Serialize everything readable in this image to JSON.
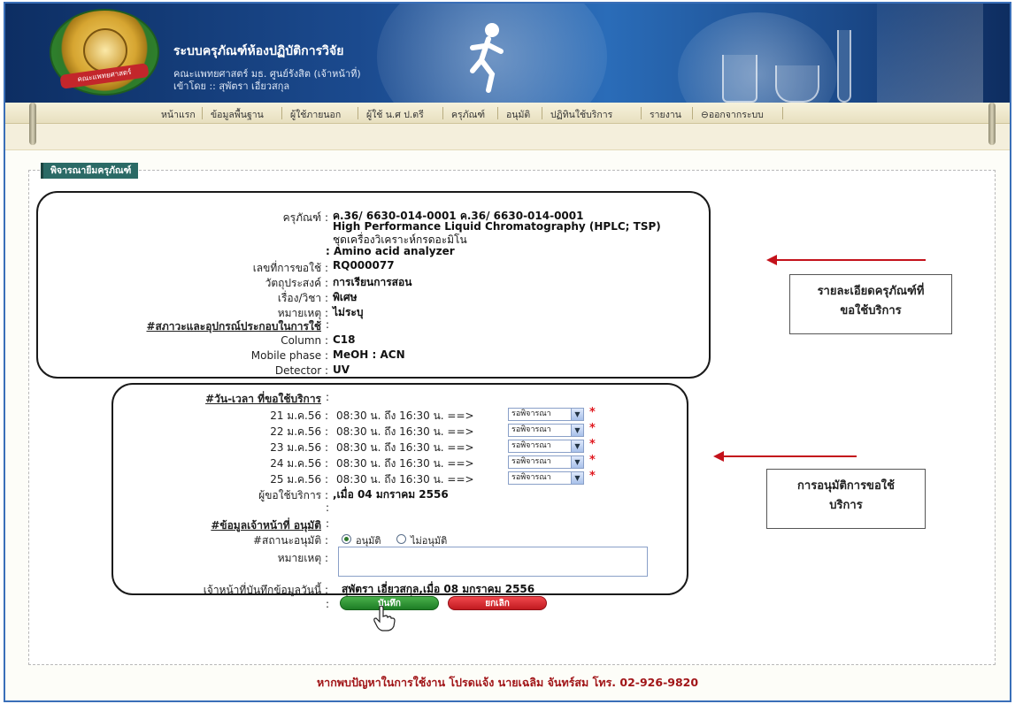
{
  "header": {
    "title": "ระบบครุภัณฑ์ห้องปฏิบัติการวิจัย",
    "subtitle": "คณะแพทยศาสตร์ มธ. ศูนย์รังสิต (เจ้าหน้าที่)",
    "logged_in": "เข้าโดย :: สุพัตรา เอี่ยวสกุล",
    "logo_text": "คณะแพทยศาสตร์"
  },
  "nav": {
    "items": [
      "หน้าแรก",
      "ข้อมูลพื้นฐาน",
      "ผู้ใช้ภายนอก",
      "ผู้ใช้ น.ศ ป.ตรี",
      "ครุภัณฑ์",
      "อนุมัติ",
      "ปฏิทินใช้บริการ",
      "รายงาน",
      "ออกจากระบบ"
    ]
  },
  "panel": {
    "legend": "พิจารณายืมครุภัณฑ์"
  },
  "details": {
    "equipment_label": "ครุภัณฑ์ :",
    "equipment_line1": "ค.36/ 6630-014-0001 ค.36/ 6630-014-0001",
    "equipment_line2": "High Performance Liquid Chromatography (HPLC; TSP)",
    "equipment_line3": "ชุดเครื่องวิเคราะห์กรดอะมิโน",
    "equipment_line4": ": Amino acid analyzer",
    "request_no_label": "เลขที่การขอใช้ :",
    "request_no": "RQ000077",
    "purpose_label": "วัตถุประสงค์ :",
    "purpose": "การเรียนการสอน",
    "subject_label": "เรื่อง/วิชา :",
    "subject": "พิเศษ",
    "note_label": "หมายเหตุ :",
    "note": "ไม่ระบุ",
    "conditions_label": "#สภาวะและอุปกรณ์ประกอบในการใช้",
    "conditions_colon": ":",
    "column_label": "Column :",
    "column": "C18",
    "mobile_label": "Mobile phase :",
    "mobile": "MeOH : ACN",
    "detector_label": "Detector :",
    "detector": "UV"
  },
  "schedule": {
    "heading": "#วัน-เวลา ที่ขอใช้บริการ",
    "heading_colon": ":",
    "rows": [
      {
        "date": "21 ม.ค.56 :",
        "time": "08:30 น. ถึง 16:30 น. ==>",
        "status": "รอพิจารณา"
      },
      {
        "date": "22 ม.ค.56 :",
        "time": "08:30 น. ถึง 16:30 น. ==>",
        "status": "รอพิจารณา"
      },
      {
        "date": "23 ม.ค.56 :",
        "time": "08:30 น. ถึง 16:30 น. ==>",
        "status": "รอพิจารณา"
      },
      {
        "date": "24 ม.ค.56 :",
        "time": "08:30 น. ถึง 16:30 น. ==>",
        "status": "รอพิจารณา"
      },
      {
        "date": "25 ม.ค.56 :",
        "time": "08:30 น. ถึง 16:30 น. ==>",
        "status": "รอพิจารณา"
      }
    ],
    "required_mark": "*",
    "requester_label": "ผู้ขอใช้บริการ :",
    "requester": ",เมื่อ 04 มกราคม 2556",
    "blank_colon": ":"
  },
  "approval": {
    "heading": "#ข้อมูลเจ้าหน้าที่ อนุมัติ",
    "heading_colon": ":",
    "status_label": "#สถานะอนุมัติ :",
    "approve": "อนุมัติ",
    "reject": "ไม่อนุมัติ",
    "selected": "approve",
    "remark_label": "หมายเหตุ :",
    "remark_value": "",
    "recorder_label": "เจ้าหน้าที่บันทึกข้อมูลวันนี้ :",
    "recorder": "สุพัตรา เอี่ยวสกุล,เมื่อ 08 มกราคม 2556",
    "buttons_colon": ":",
    "save": "บันทึก",
    "cancel": "ยกเลิก"
  },
  "callouts": {
    "details_line1": "รายละเอียดครุภัณฑ์ที่",
    "details_line2": "ขอใช้บริการ",
    "approval_line1": "การอนุมัติการขอใช้",
    "approval_line2": "บริการ"
  },
  "footer": {
    "text": "หากพบปัญหาในการใช้งาน โปรดแจ้ง นายเฉลิม จันทร์สม โทร. 02-926-9820"
  },
  "colors": {
    "banner": "#1b4a8e",
    "legend": "#2b6a66",
    "save": "#1d7d25",
    "cancel": "#c11a20",
    "footer_text": "#a11518",
    "arrow": "#c4121b"
  }
}
